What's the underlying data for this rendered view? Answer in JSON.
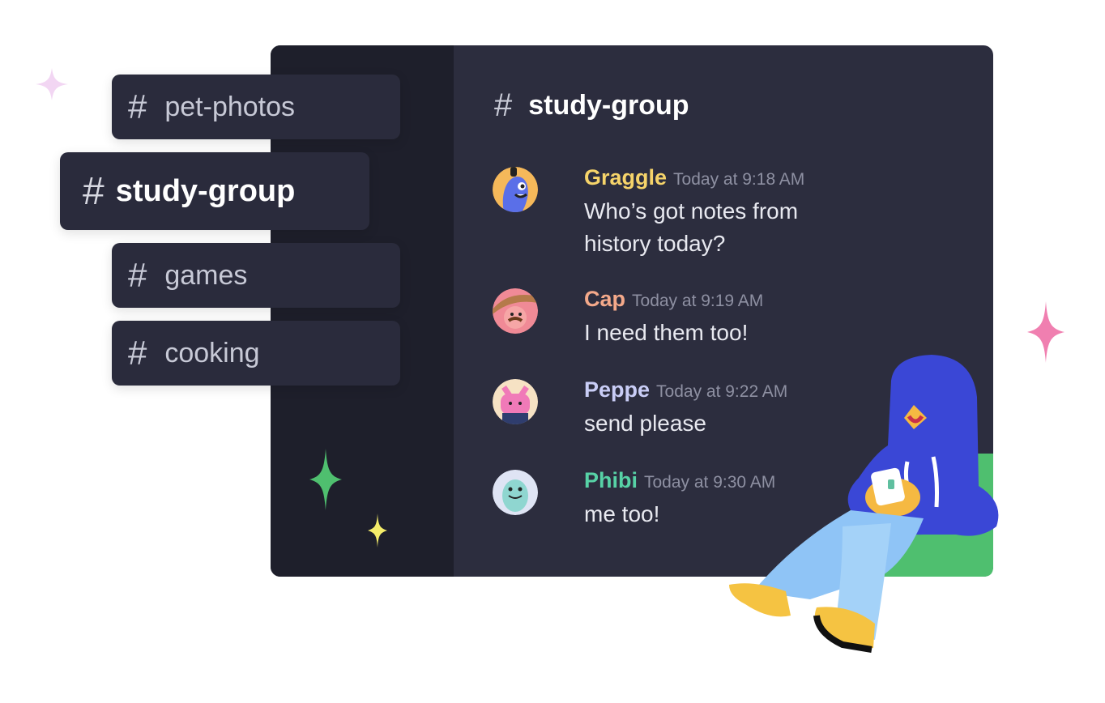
{
  "channels": [
    {
      "name": "pet-photos",
      "icon": "hash-icon",
      "active": false
    },
    {
      "name": "study-group",
      "icon": "hash-icon",
      "active": true
    },
    {
      "name": "games",
      "icon": "hash-icon",
      "active": false
    },
    {
      "name": "cooking",
      "icon": "hash-icon",
      "active": false
    }
  ],
  "hash_glyph": "#",
  "chat": {
    "channel_title": "study-group",
    "messages": [
      {
        "author": "Graggle",
        "author_color": "#f6d46a",
        "time": "Today at 9:18 AM",
        "text": "Who’s got notes from history today?"
      },
      {
        "author": "Cap",
        "author_color": "#f4a98a",
        "time": "Today at 9:19 AM",
        "text": "I need them too!"
      },
      {
        "author": "Peppe",
        "author_color": "#c9cdf6",
        "time": "Today at 9:22 AM",
        "text": "send please"
      },
      {
        "author": "Phibi",
        "author_color": "#57d2a6",
        "time": "Today at 9:30 AM",
        "text": "me too!"
      }
    ]
  },
  "colors": {
    "window_bg": "#2c2d3e",
    "sidebar_bg": "#1e1f2b",
    "sparkle_pink": "#f07fb0",
    "sparkle_green": "#4fbf6f",
    "sparkle_yellow": "#f4ec6a"
  }
}
